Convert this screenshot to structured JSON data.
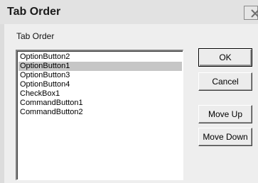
{
  "window": {
    "title": "Tab Order"
  },
  "group": {
    "label": "Tab Order"
  },
  "list": {
    "items": [
      "OptionButton2",
      "OptionButton1",
      "OptionButton3",
      "OptionButton4",
      "CheckBox1",
      "CommandButton1",
      "CommandButton2"
    ],
    "selected_index": 1
  },
  "buttons": {
    "ok": "OK",
    "cancel": "Cancel",
    "move_up": "Move Up",
    "move_down": "Move Down"
  },
  "icons": {
    "close": "close-icon"
  },
  "colors": {
    "selection": "#c6c6c6",
    "titlebar": "#e2e2e2",
    "face": "#ececec"
  }
}
